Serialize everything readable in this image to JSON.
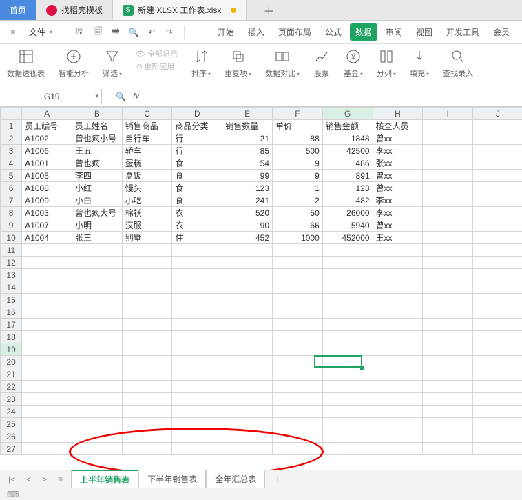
{
  "top_tabs": {
    "home": "首页",
    "template": "找稻壳模板",
    "doc": "新建 XLSX 工作表.xlsx"
  },
  "file_menu": "文件",
  "ribbon": [
    "开始",
    "插入",
    "页面布局",
    "公式",
    "数据",
    "审阅",
    "视图",
    "开发工具",
    "会员"
  ],
  "ribbon_active_index": 4,
  "tools": {
    "pivot": "数据透视表",
    "smart": "智能分析",
    "filter": "筛选",
    "showall": "全部显示",
    "reapply": "重新应用",
    "sort": "排序",
    "dup": "重复项",
    "compare": "数据对比",
    "stock": "股票",
    "fund": "基金",
    "split": "分列",
    "fill": "填充",
    "find": "查找录入"
  },
  "name_box": "G19",
  "columns": [
    "A",
    "B",
    "C",
    "D",
    "E",
    "F",
    "G",
    "H",
    "I",
    "J"
  ],
  "active_col_index": 6,
  "active_row": 19,
  "headers": [
    "员工编号",
    "员工姓名",
    "销售商品",
    "商品分类",
    "销售数量",
    "单价",
    "销售金额",
    "核查人员"
  ],
  "rows": [
    [
      "A1002",
      "曾也疯小号",
      "自行车",
      "行",
      "21",
      "88",
      "1848",
      "曾xx"
    ],
    [
      "A1006",
      "王五",
      "轿车",
      "行",
      "85",
      "500",
      "42500",
      "李xx"
    ],
    [
      "A1001",
      "曾也疯",
      "蛋糕",
      "食",
      "54",
      "9",
      "486",
      "张xx"
    ],
    [
      "A1005",
      "李四",
      "盒饭",
      "食",
      "99",
      "9",
      "891",
      "曾xx"
    ],
    [
      "A1008",
      "小红",
      "馒头",
      "食",
      "123",
      "1",
      "123",
      "曾xx"
    ],
    [
      "A1009",
      "小白",
      "小吃",
      "食",
      "241",
      "2",
      "482",
      "李xx"
    ],
    [
      "A1003",
      "曾也疯大号",
      "棉袄",
      "衣",
      "520",
      "50",
      "26000",
      "李xx"
    ],
    [
      "A1007",
      "小明",
      "汉服",
      "衣",
      "90",
      "66",
      "5940",
      "曾xx"
    ],
    [
      "A1004",
      "张三",
      "别墅",
      "住",
      "452",
      "1000",
      "452000",
      "王xx"
    ]
  ],
  "total_rows": 27,
  "sheets": [
    "上半年销售表",
    "下半年销售表",
    "全年汇总表"
  ],
  "sheet_active_index": 0,
  "chart_data": {
    "type": "table",
    "title": "",
    "columns": [
      "员工编号",
      "员工姓名",
      "销售商品",
      "商品分类",
      "销售数量",
      "单价",
      "销售金额",
      "核查人员"
    ],
    "records": [
      {
        "员工编号": "A1002",
        "员工姓名": "曾也疯小号",
        "销售商品": "自行车",
        "商品分类": "行",
        "销售数量": 21,
        "单价": 88,
        "销售金额": 1848,
        "核查人员": "曾xx"
      },
      {
        "员工编号": "A1006",
        "员工姓名": "王五",
        "销售商品": "轿车",
        "商品分类": "行",
        "销售数量": 85,
        "单价": 500,
        "销售金额": 42500,
        "核查人员": "李xx"
      },
      {
        "员工编号": "A1001",
        "员工姓名": "曾也疯",
        "销售商品": "蛋糕",
        "商品分类": "食",
        "销售数量": 54,
        "单价": 9,
        "销售金额": 486,
        "核查人员": "张xx"
      },
      {
        "员工编号": "A1005",
        "员工姓名": "李四",
        "销售商品": "盒饭",
        "商品分类": "食",
        "销售数量": 99,
        "单价": 9,
        "销售金额": 891,
        "核查人员": "曾xx"
      },
      {
        "员工编号": "A1008",
        "员工姓名": "小红",
        "销售商品": "馒头",
        "商品分类": "食",
        "销售数量": 123,
        "单价": 1,
        "销售金额": 123,
        "核查人员": "曾xx"
      },
      {
        "员工编号": "A1009",
        "员工姓名": "小白",
        "销售商品": "小吃",
        "商品分类": "食",
        "销售数量": 241,
        "单价": 2,
        "销售金额": 482,
        "核查人员": "李xx"
      },
      {
        "员工编号": "A1003",
        "员工姓名": "曾也疯大号",
        "销售商品": "棉袄",
        "商品分类": "衣",
        "销售数量": 520,
        "单价": 50,
        "销售金额": 26000,
        "核查人员": "李xx"
      },
      {
        "员工编号": "A1007",
        "员工姓名": "小明",
        "销售商品": "汉服",
        "商品分类": "衣",
        "销售数量": 90,
        "单价": 66,
        "销售金额": 5940,
        "核查人员": "曾xx"
      },
      {
        "员工编号": "A1004",
        "员工姓名": "张三",
        "销售商品": "别墅",
        "商品分类": "住",
        "销售数量": 452,
        "单价": 1000,
        "销售金额": 452000,
        "核查人员": "王xx"
      }
    ]
  }
}
